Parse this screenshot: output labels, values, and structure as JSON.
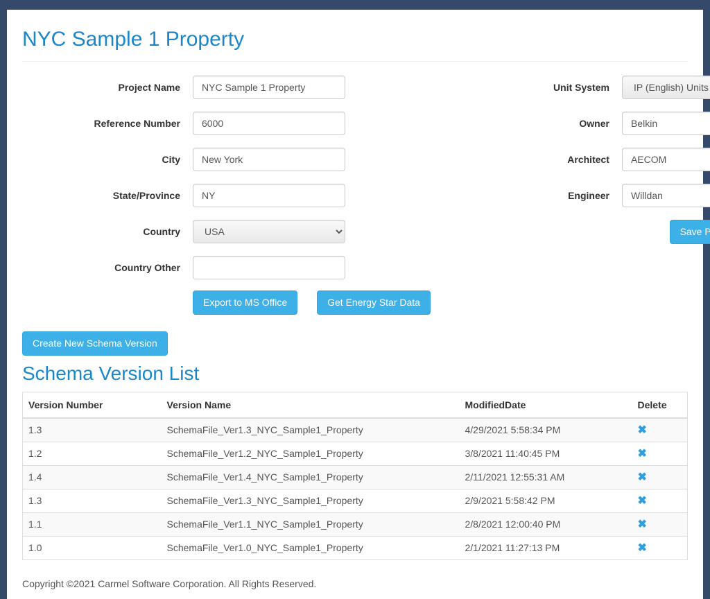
{
  "page": {
    "title": "NYC Sample 1 Property",
    "subtitle": "Schema Version List"
  },
  "labels": {
    "project_name": "Project Name",
    "reference_number": "Reference Number",
    "city": "City",
    "state": "State/Province",
    "country": "Country",
    "country_other": "Country Other",
    "unit_system": "Unit System",
    "owner": "Owner",
    "architect": "Architect",
    "engineer": "Engineer"
  },
  "values": {
    "project_name": "NYC Sample 1 Property",
    "reference_number": "6000",
    "city": "New York",
    "state": "NY",
    "country": "USA",
    "country_other": "",
    "unit_system": "IP (English) Units",
    "owner": "Belkin",
    "architect": "AECOM",
    "engineer": "Willdan"
  },
  "buttons": {
    "export": "Export to MS Office",
    "energy_star": "Get Energy Star Data",
    "save_inputs": "Save Project Inputs",
    "create_schema": "Create New Schema Version"
  },
  "table": {
    "headers": {
      "version_number": "Version Number",
      "version_name": "Version Name",
      "modified_date": "ModifiedDate",
      "delete": "Delete"
    },
    "rows": [
      {
        "number": "1.3",
        "name": "SchemaFile_Ver1.3_NYC_Sample1_Property",
        "modified": "4/29/2021 5:58:34 PM"
      },
      {
        "number": "1.2",
        "name": "SchemaFile_Ver1.2_NYC_Sample1_Property",
        "modified": "3/8/2021 11:40:45 PM"
      },
      {
        "number": "1.4",
        "name": "SchemaFile_Ver1.4_NYC_Sample1_Property",
        "modified": "2/11/2021 12:55:31 AM"
      },
      {
        "number": "1.3",
        "name": "SchemaFile_Ver1.3_NYC_Sample1_Property",
        "modified": "2/9/2021 5:58:42 PM"
      },
      {
        "number": "1.1",
        "name": "SchemaFile_Ver1.1_NYC_Sample1_Property",
        "modified": "2/8/2021 12:00:40 PM"
      },
      {
        "number": "1.0",
        "name": "SchemaFile_Ver1.0_NYC_Sample1_Property",
        "modified": "2/1/2021 11:27:13 PM"
      }
    ]
  },
  "footer": {
    "copyright": "Copyright ©2021 Carmel Software Corporation. All Rights Reserved."
  }
}
